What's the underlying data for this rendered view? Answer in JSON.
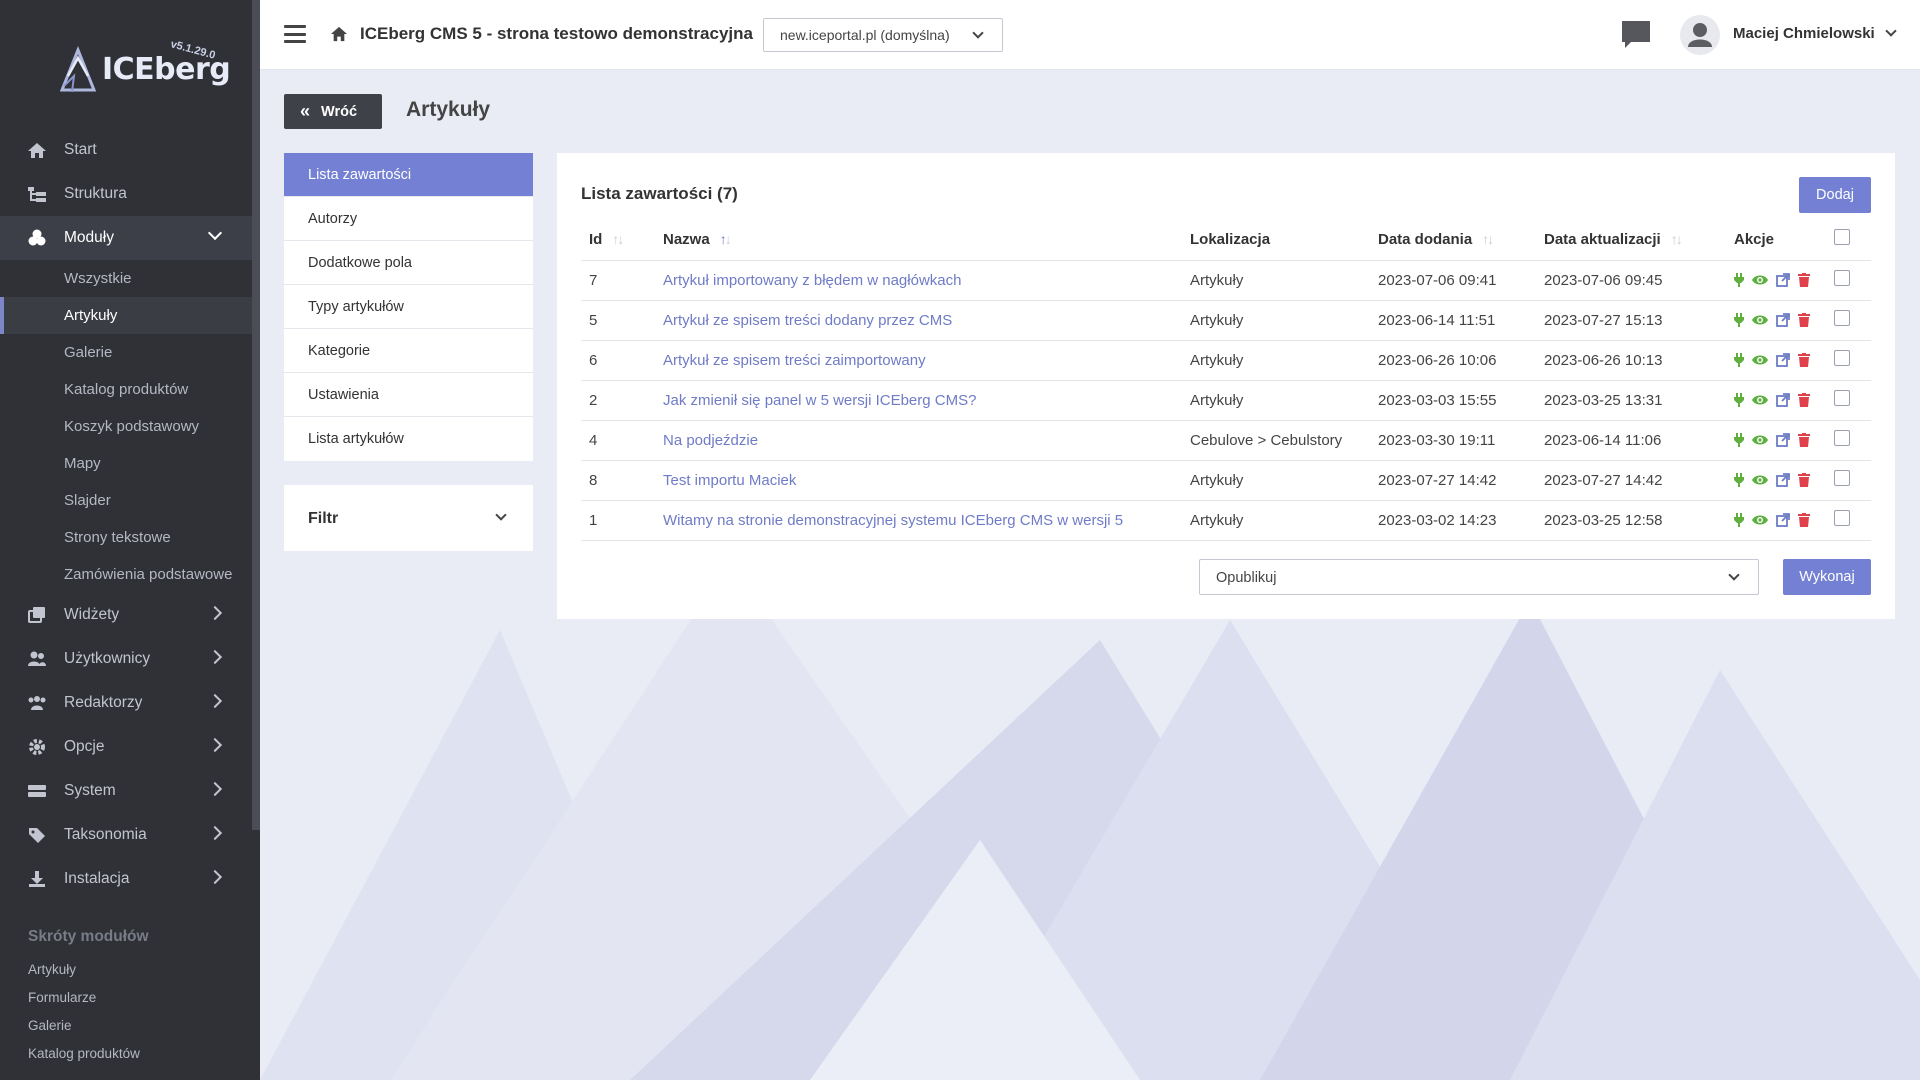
{
  "brand": {
    "name": "ICEberg",
    "version": "v5.1.29.0"
  },
  "sidebar": {
    "nav": [
      {
        "label": "Start",
        "icon": "home-icon"
      },
      {
        "label": "Struktura",
        "icon": "sitemap-icon"
      },
      {
        "label": "Moduły",
        "icon": "cubes-icon",
        "expanded": true,
        "children": [
          "Wszystkie",
          "Artykuły",
          "Galerie",
          "Katalog produktów",
          "Koszyk podstawowy",
          "Mapy",
          "Slajder",
          "Strony tekstowe",
          "Zamówienia podstawowe"
        ],
        "active_child": "Artykuły"
      },
      {
        "label": "Widżety",
        "icon": "clone-icon"
      },
      {
        "label": "Użytkownicy",
        "icon": "users-icon"
      },
      {
        "label": "Redaktorzy",
        "icon": "user-group-icon"
      },
      {
        "label": "Opcje",
        "icon": "gear-icon"
      },
      {
        "label": "System",
        "icon": "server-icon"
      },
      {
        "label": "Taksonomia",
        "icon": "tag-icon"
      },
      {
        "label": "Instalacja",
        "icon": "download-icon"
      }
    ],
    "shortcuts_title": "Skróty modułów",
    "shortcuts": [
      "Artykuły",
      "Formularze",
      "Galerie",
      "Katalog produktów"
    ]
  },
  "topbar": {
    "site_title": "ICEberg CMS 5 - strona testowo demonstracyjna",
    "domain": "new.iceportal.pl (domyślna)",
    "user": "Maciej Chmielowski"
  },
  "page": {
    "back_label": "Wróć",
    "title": "Artykuły"
  },
  "side_menu": {
    "items": [
      "Lista zawartości",
      "Autorzy",
      "Dodatkowe pola",
      "Typy artykułów",
      "Kategorie",
      "Ustawienia",
      "Lista artykułów"
    ],
    "active": "Lista zawartości",
    "filter_label": "Filtr"
  },
  "list": {
    "title": "Lista zawartości (7)",
    "add_label": "Dodaj",
    "columns": {
      "id": "Id",
      "name": "Nazwa",
      "location": "Lokalizacja",
      "added": "Data dodania",
      "updated": "Data aktualizacji",
      "actions": "Akcje"
    },
    "rows": [
      {
        "id": "7",
        "name": "Artykuł importowany z błędem w nagłówkach",
        "location": "Artykuły",
        "added": "2023-07-06 09:41",
        "updated": "2023-07-06 09:45"
      },
      {
        "id": "5",
        "name": "Artykuł ze spisem treści dodany przez CMS",
        "location": "Artykuły",
        "added": "2023-06-14 11:51",
        "updated": "2023-07-27 15:13"
      },
      {
        "id": "6",
        "name": "Artykuł ze spisem treści zaimportowany",
        "location": "Artykuły",
        "added": "2023-06-26 10:06",
        "updated": "2023-06-26 10:13"
      },
      {
        "id": "2",
        "name": "Jak zmienił się panel w 5 wersji ICEberg CMS?",
        "location": "Artykuły",
        "added": "2023-03-03 15:55",
        "updated": "2023-03-25 13:31"
      },
      {
        "id": "4",
        "name": "Na podjeździe",
        "location": "Cebulove > Cebulstory",
        "added": "2023-03-30 19:11",
        "updated": "2023-06-14 11:06"
      },
      {
        "id": "8",
        "name": "Test importu Maciek",
        "location": "Artykuły",
        "added": "2023-07-27 14:42",
        "updated": "2023-07-27 14:42"
      },
      {
        "id": "1",
        "name": "Witamy na stronie demonstracyjnej systemu ICEberg CMS w wersji 5",
        "location": "Artykuły",
        "added": "2023-03-02 14:23",
        "updated": "2023-03-25 12:58"
      }
    ],
    "bulk_action": "Opublikuj",
    "execute_label": "Wykonaj"
  },
  "colors": {
    "accent": "#7480d3",
    "sidebar_bg": "#2f3136",
    "link": "#6f7bc7",
    "publish": "#5fae3e",
    "delete": "#e0424b"
  }
}
